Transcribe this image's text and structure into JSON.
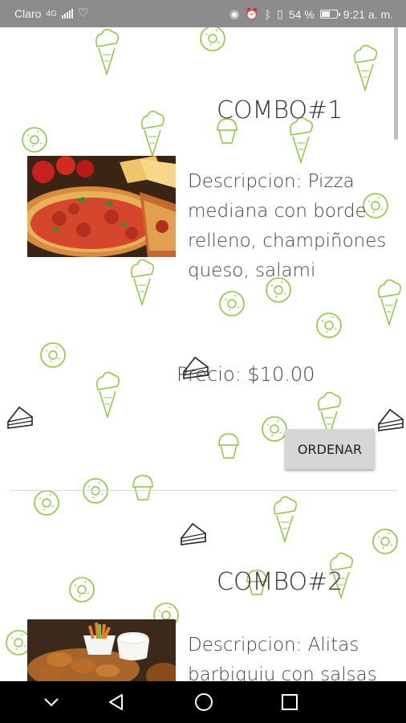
{
  "status_bar": {
    "carrier": "Claro",
    "network": "4G",
    "battery_percent": "54 %",
    "time": "9:21 a. m."
  },
  "combos": [
    {
      "title": "COMBO#1",
      "description": "Descripcion: Pizza mediana con borde relleno, champiñones queso, salami",
      "price": "Precio: $10.00",
      "button_label": "ORDENAR",
      "image": "pizza-photo"
    },
    {
      "title": "COMBO#2",
      "description": "Descripcion: Alitas barbiquiu con salsas",
      "image": "wings-photo"
    }
  ],
  "nav_bar": {
    "icons": [
      "chevron-down-icon",
      "back-icon",
      "home-icon",
      "recents-icon"
    ]
  },
  "colors": {
    "status_bar": "#8c8c8c",
    "pattern_green": "#8cc63f",
    "button_bg": "#d6d6d6",
    "nav_bar": "#000000"
  }
}
